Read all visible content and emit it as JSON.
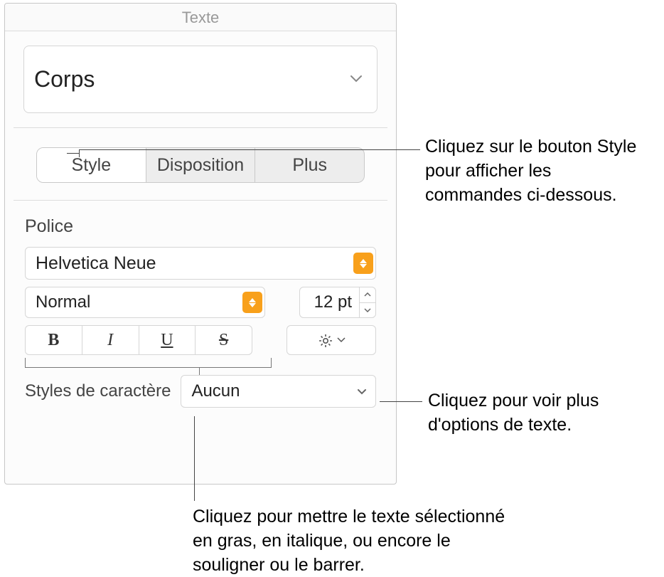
{
  "panel": {
    "title": "Texte",
    "paragraph_style": "Corps",
    "tabs": {
      "style": "Style",
      "disposition": "Disposition",
      "plus": "Plus"
    },
    "font": {
      "section_label": "Police",
      "family": "Helvetica Neue",
      "style": "Normal",
      "size": "12 pt"
    },
    "format_buttons": {
      "bold": "B",
      "italic": "I",
      "underline": "U",
      "strike": "S"
    },
    "char_styles": {
      "label": "Styles de caractère",
      "value": "Aucun"
    }
  },
  "callouts": {
    "c1": "Cliquez sur le bouton Style pour afficher les commandes ci-dessous.",
    "c2": "Cliquez pour voir plus d'options de texte.",
    "c3": "Cliquez pour mettre le texte sélectionné en gras, en italique, ou encore le souligner ou le barrer."
  }
}
